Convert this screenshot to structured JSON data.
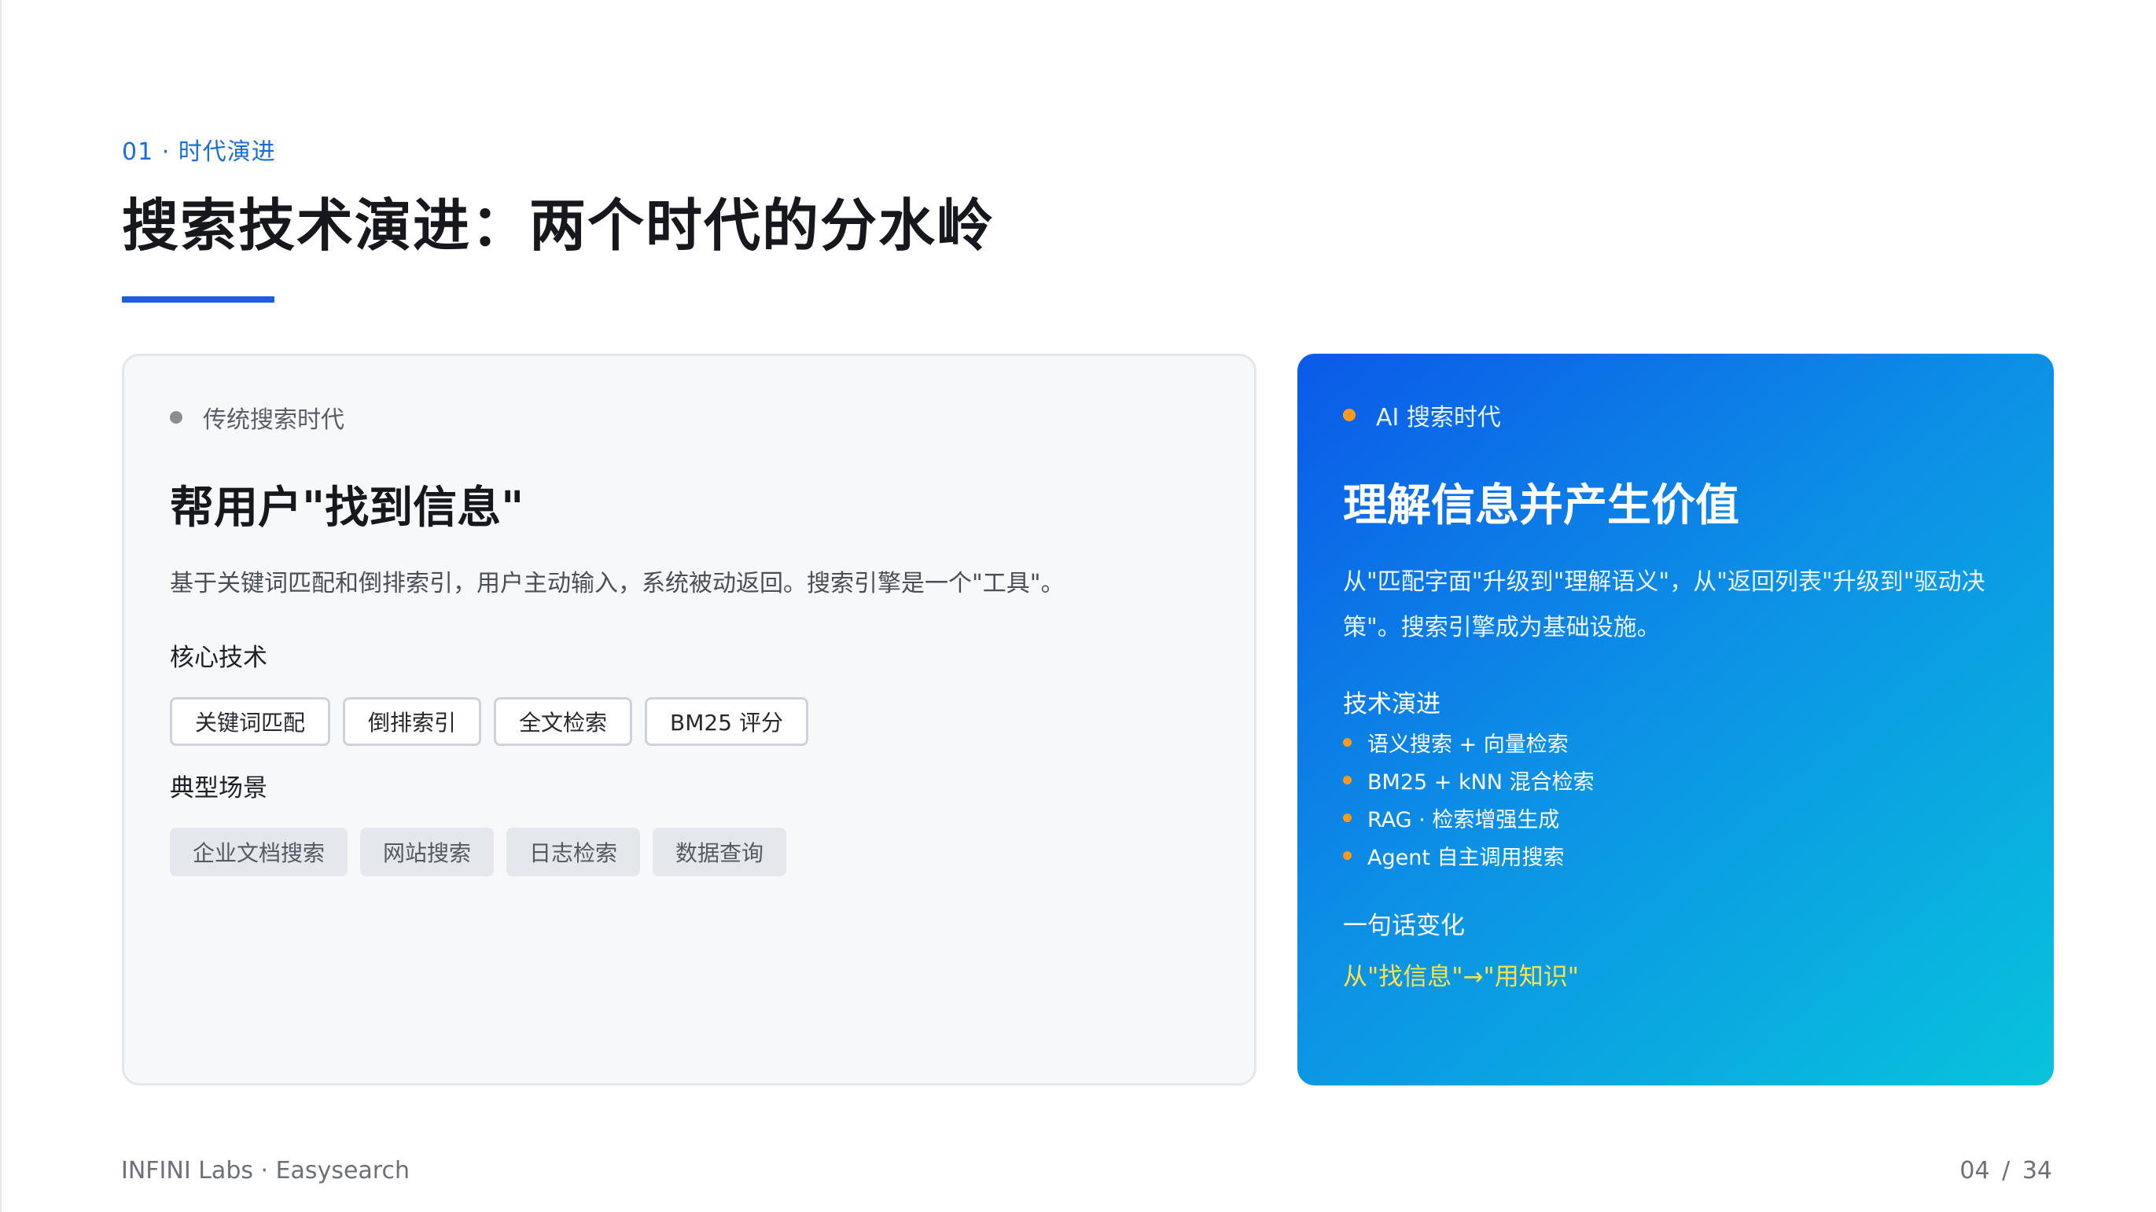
{
  "header": {
    "section_tag": "01 · 时代演进",
    "title": "搜索技术演进：两个时代的分水岭"
  },
  "traditional": {
    "era_label": "传统搜索时代",
    "headline": "帮用户\"找到信息\"",
    "description": "基于关键词匹配和倒排索引，用户主动输入，系统被动返回。搜索引擎是一个\"工具\"。",
    "core_tech_heading": "核心技术",
    "core_tech": [
      "关键词匹配",
      "倒排索引",
      "全文检索",
      "BM25 评分"
    ],
    "scenarios_heading": "典型场景",
    "scenarios": [
      "企业文档搜索",
      "网站搜索",
      "日志检索",
      "数据查询"
    ]
  },
  "ai": {
    "era_label": "AI 搜索时代",
    "headline": "理解信息并产生价值",
    "description": "从\"匹配字面\"升级到\"理解语义\"，从\"返回列表\"升级到\"驱动决策\"。搜索引擎成为基础设施。",
    "evolution_heading": "技术演进",
    "evolution": [
      "语义搜索 + 向量检索",
      "BM25 + kNN 混合检索",
      "RAG · 检索增强生成",
      "Agent 自主调用搜索"
    ],
    "summary_heading": "一句话变化",
    "summary": "从\"找信息\"→\"用知识\""
  },
  "footer": {
    "brand": "INFINI Labs · Easysearch",
    "page_current": "04",
    "page_separator": "/",
    "page_total": "34"
  },
  "colors": {
    "accent": "#1a5fe0",
    "gradient_start": "#0b5ae8",
    "gradient_end": "#08c3dc",
    "bullet_orange": "#ff9a1f",
    "highlight_yellow": "#ffe24a"
  }
}
